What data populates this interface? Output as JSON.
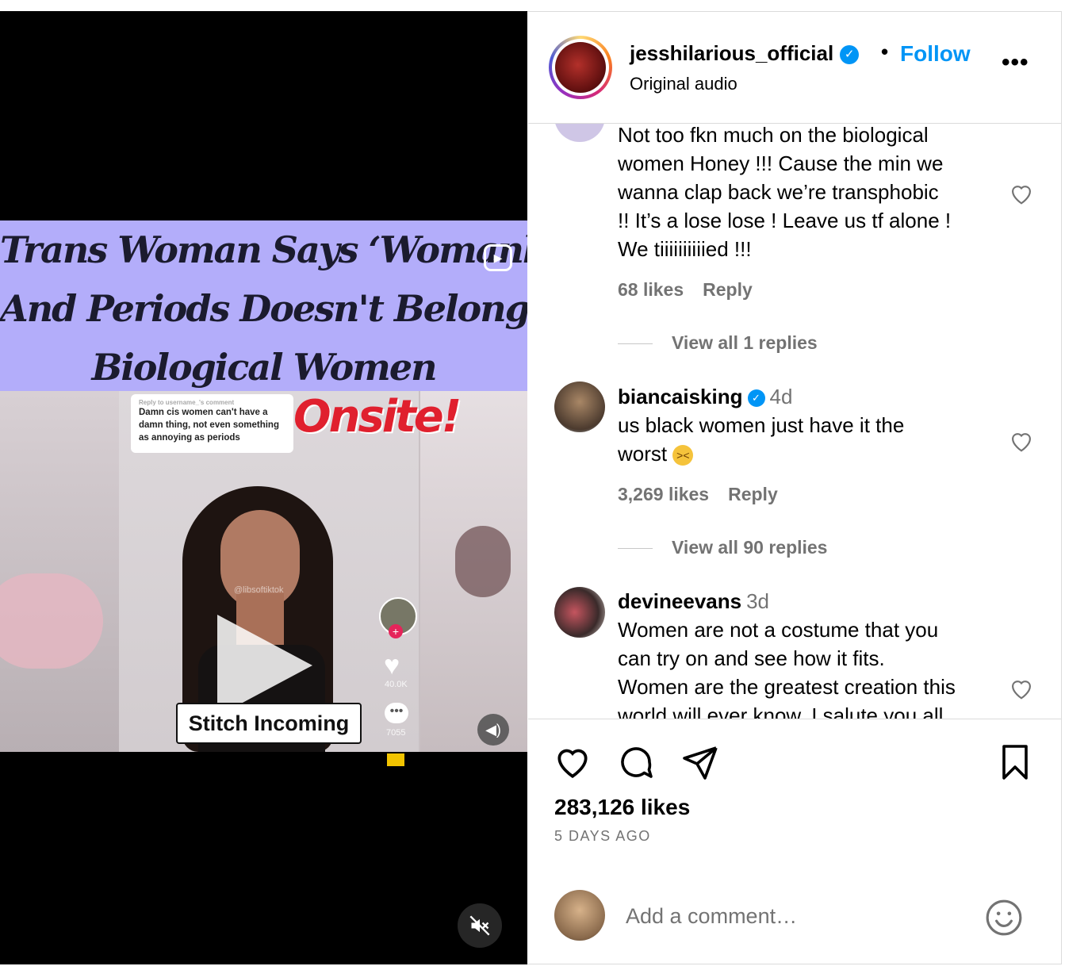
{
  "post": {
    "username": "jesshilarious_official",
    "follow_label": "Follow",
    "separator": "•",
    "audio_label": "Original audio",
    "more_label": "•••"
  },
  "video": {
    "banner_lines": [
      "Trans Woman Says ‘Womanhood’",
      "And Periods Doesn't Belong To",
      "Biological Women"
    ],
    "bubble_header": "Reply to username_'s comment",
    "bubble_text": "Damn cis women can't have a damn thing, not even something as annoying as periods",
    "brand": "Onsite!",
    "caption": "Stitch Incoming",
    "watermark": "@libsoftiktok",
    "tt_likes": "40.0K",
    "tt_comments": "7055"
  },
  "comments": [
    {
      "text": "Not too fkn much on the biological women Honey !!! Cause the min we wanna clap back we’re transphobic !! It’s a lose lose ! Leave us tf alone ! We tiiiiiiiiiied !!!",
      "lines": [
        "Not too fkn much on the biological",
        "women Honey !!! Cause the min we",
        "wanna clap back we’re transphobic",
        "!! It’s a lose lose ! Leave us tf alone !",
        "We tiiiiiiiiiied !!!"
      ],
      "likes": "68 likes",
      "reply": "Reply",
      "view_replies": "View all 1 replies"
    },
    {
      "user": "biancaisking",
      "time": "4d",
      "lines": [
        "us black women just have it the",
        "worst"
      ],
      "emoji": "tired-face-emoji",
      "likes": "3,269 likes",
      "reply": "Reply",
      "view_replies": "View all 90 replies"
    },
    {
      "user": "devineevans",
      "time": "3d",
      "lines": [
        "Women are not a costume that you",
        "can try on and see how it fits.",
        "Women are the greatest creation this",
        "world will ever know. I salute you all"
      ]
    }
  ],
  "footer": {
    "likes": "283,126 likes",
    "time_ago": "5 DAYS AGO",
    "comment_placeholder": "Add a comment…"
  },
  "icons": [
    "reel-icon",
    "play-icon",
    "volume-icon",
    "mute-icon",
    "verified-icon",
    "more-icon",
    "heart-icon",
    "comment-icon",
    "share-icon",
    "bookmark-icon",
    "emoji-icon"
  ],
  "colors": {
    "accent": "#0095f6",
    "muted": "#737373",
    "banner": "#b3adfa",
    "brand_red": "#e0202e"
  }
}
